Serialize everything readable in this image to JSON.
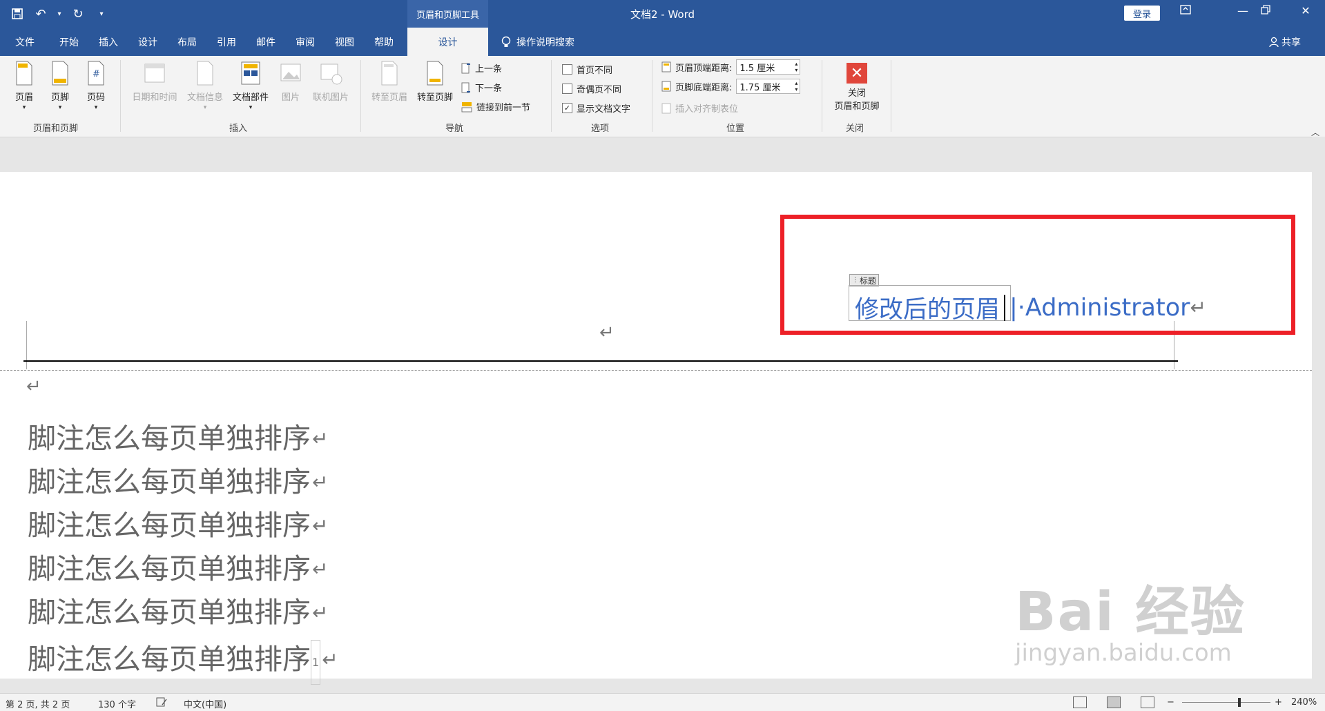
{
  "titlebar": {
    "context_tool": "页眉和页脚工具",
    "doc_title": "文档2  -  Word",
    "login": "登录"
  },
  "tabs": {
    "file": "文件",
    "home": "开始",
    "insert": "插入",
    "design1": "设计",
    "layout": "布局",
    "references": "引用",
    "mailings": "邮件",
    "review": "审阅",
    "view": "视图",
    "help": "帮助",
    "design_active": "设计",
    "search": "操作说明搜索",
    "share": "共享"
  },
  "ribbon": {
    "header": "页眉",
    "footer": "页脚",
    "page_number": "页码",
    "group_hf": "页眉和页脚",
    "date_time": "日期和时间",
    "doc_info": "文档信息",
    "doc_parts": "文档部件",
    "picture": "图片",
    "online_picture": "联机图片",
    "group_insert": "插入",
    "goto_header": "转至页眉",
    "goto_footer": "转至页脚",
    "prev": "上一条",
    "next": "下一条",
    "link_prev": "链接到前一节",
    "group_nav": "导航",
    "diff_first": "首页不同",
    "diff_odd_even": "奇偶页不同",
    "show_text": "显示文档文字",
    "group_options": "选项",
    "header_top_label": "页眉顶端距离:",
    "header_top_value": "1.5 厘米",
    "footer_bottom_label": "页脚底端距离:",
    "footer_bottom_value": "1.75 厘米",
    "insert_align_tab": "插入对齐制表位",
    "group_position": "位置",
    "close_line1": "关闭",
    "close_line2": "页眉和页脚",
    "group_close": "关闭"
  },
  "document": {
    "field_tag": "标题",
    "header_title": "修改后的页眉",
    "header_author": "|·Administrator",
    "para_mark": "↵",
    "body_lines": [
      "脚注怎么每页单独排序",
      "脚注怎么每页单独排序",
      "脚注怎么每页单独排序",
      "脚注怎么每页单独排序",
      "脚注怎么每页单独排序",
      "脚注怎么每页单独排序"
    ],
    "footnote_ref": "1"
  },
  "watermark": {
    "brand": "Bai 经验",
    "url": "jingyan.baidu.com"
  },
  "status": {
    "page": "第 2 页, 共 2 页",
    "words": "130 个字",
    "language": "中文(中国)",
    "zoom": "240%"
  },
  "colors": {
    "ribbon_blue": "#2b579a",
    "highlight_red": "#ed2027",
    "header_text_blue": "#3b6cc6"
  }
}
